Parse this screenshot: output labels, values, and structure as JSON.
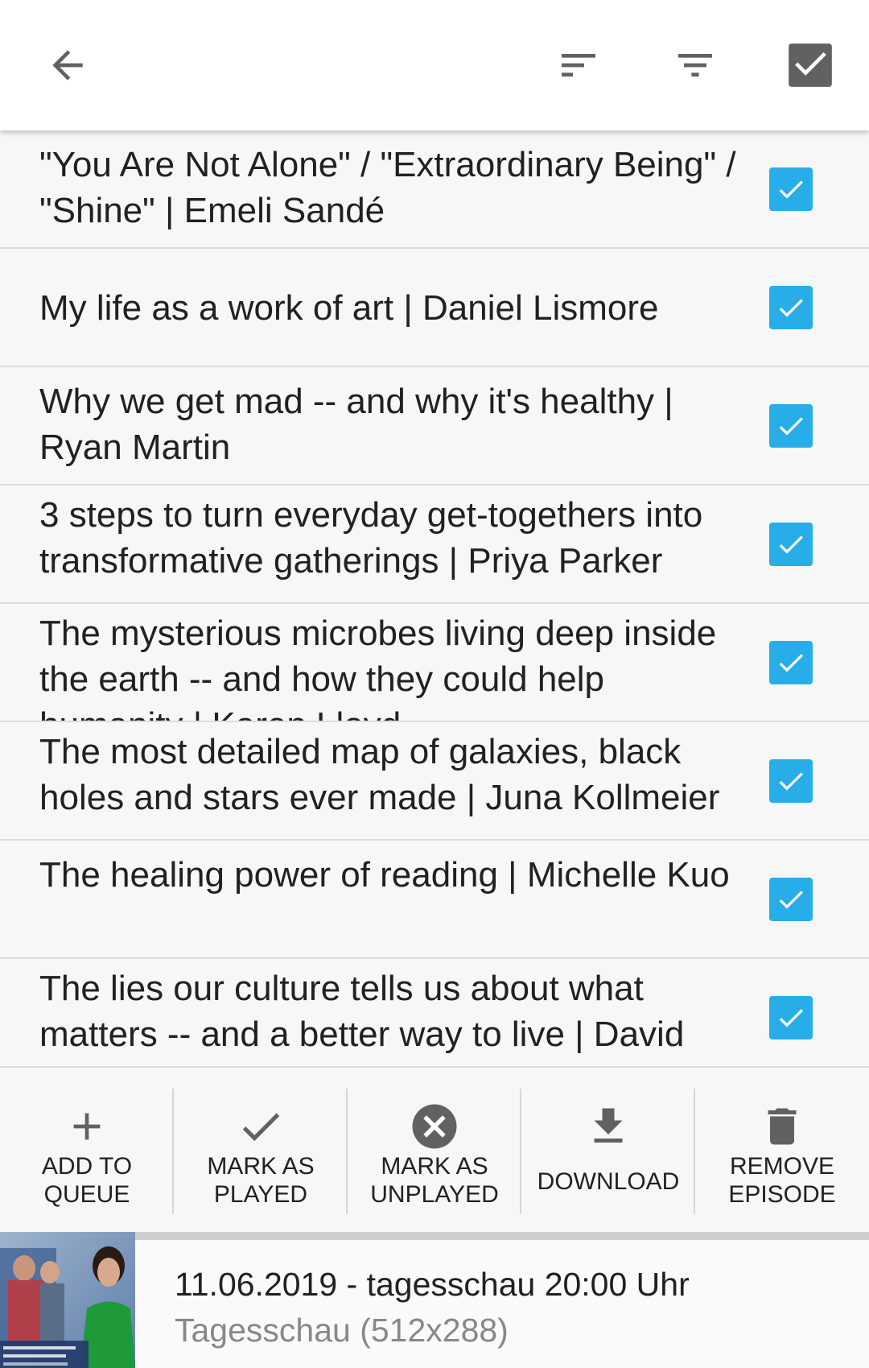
{
  "toolbar": {
    "back_icon": "arrow-left-icon",
    "sort_icon": "sort-icon",
    "filter_icon": "filter-icon",
    "select_all_icon": "checkbox-checked-icon"
  },
  "episodes": [
    {
      "title": "\"You Are Not Alone\" / \"Extraordinary Being\" / \"Shine\" | Emeli Sandé",
      "checked": true
    },
    {
      "title": "My life as a work of art | Daniel Lismore",
      "checked": true
    },
    {
      "title": "Why we get mad -- and why it's healthy | Ryan Martin",
      "checked": true
    },
    {
      "title": "3 steps to turn everyday get-togethers into transformative gatherings | Priya Parker",
      "checked": true
    },
    {
      "title": "The mysterious microbes living deep inside the earth -- and how they could help humanity | Karen Lloyd",
      "checked": true
    },
    {
      "title": "The most detailed map of galaxies, black holes and stars ever made | Juna Kollmeier",
      "checked": true
    },
    {
      "title": "The healing power of reading | Michelle Kuo",
      "checked": true
    },
    {
      "title": "The lies our culture tells us about what matters -- and a better way to live | David Brooks",
      "checked": true
    }
  ],
  "actions": [
    {
      "label": "ADD TO\nQUEUE",
      "icon": "plus-icon"
    },
    {
      "label": "MARK AS\nPLAYED",
      "icon": "check-icon"
    },
    {
      "label": "MARK AS\nUNPLAYED",
      "icon": "cancel-circle-icon"
    },
    {
      "label": "DOWNLOAD",
      "icon": "download-icon"
    },
    {
      "label": "REMOVE\nEPISODE",
      "icon": "trash-icon"
    }
  ],
  "player": {
    "title": "11.06.2019 - tagesschau 20:00 Uhr",
    "subtitle": "Tagesschau (512x288)"
  },
  "colors": {
    "checkbox": "#27aee8",
    "icon": "#616161",
    "text": "#212121",
    "subtitle": "#888888"
  }
}
